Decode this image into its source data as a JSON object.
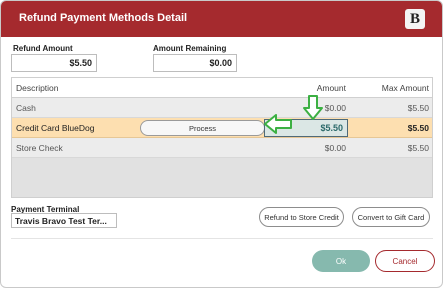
{
  "dialog": {
    "title": "Refund Payment Methods Detail",
    "logo_letter": "B"
  },
  "refund_amount": {
    "label": "Refund Amount",
    "value": "$5.50"
  },
  "amount_remaining": {
    "label": "Amount Remaining",
    "value": "$0.00"
  },
  "table": {
    "headers": {
      "description": "Description",
      "amount": "Amount",
      "max_amount": "Max Amount"
    },
    "rows": [
      {
        "description": "Cash",
        "amount": "$0.00",
        "max_amount": "$5.50"
      },
      {
        "description": "Credit Card BlueDog",
        "amount": "$5.50",
        "max_amount": "$5.50",
        "selected": true,
        "process_label": "Process"
      },
      {
        "description": "Store Check",
        "amount": "$0.00",
        "max_amount": "$5.50"
      }
    ]
  },
  "payment_terminal": {
    "label": "Payment Terminal",
    "value": "Travis Bravo Test Ter..."
  },
  "buttons": {
    "refund_store_credit": "Refund to Store Credit",
    "convert_gift_card": "Convert to Gift Card",
    "ok": "Ok",
    "cancel": "Cancel"
  },
  "colors": {
    "title_bar": "#a52a2e",
    "selected_row": "#fddfb0",
    "ok_button": "#86b9ae",
    "annotation_arrow": "#3cb043"
  },
  "icons": {
    "logo": "b-logo-icon",
    "annotations": [
      "down-arrow-annotation-icon",
      "left-arrow-annotation-icon"
    ]
  }
}
